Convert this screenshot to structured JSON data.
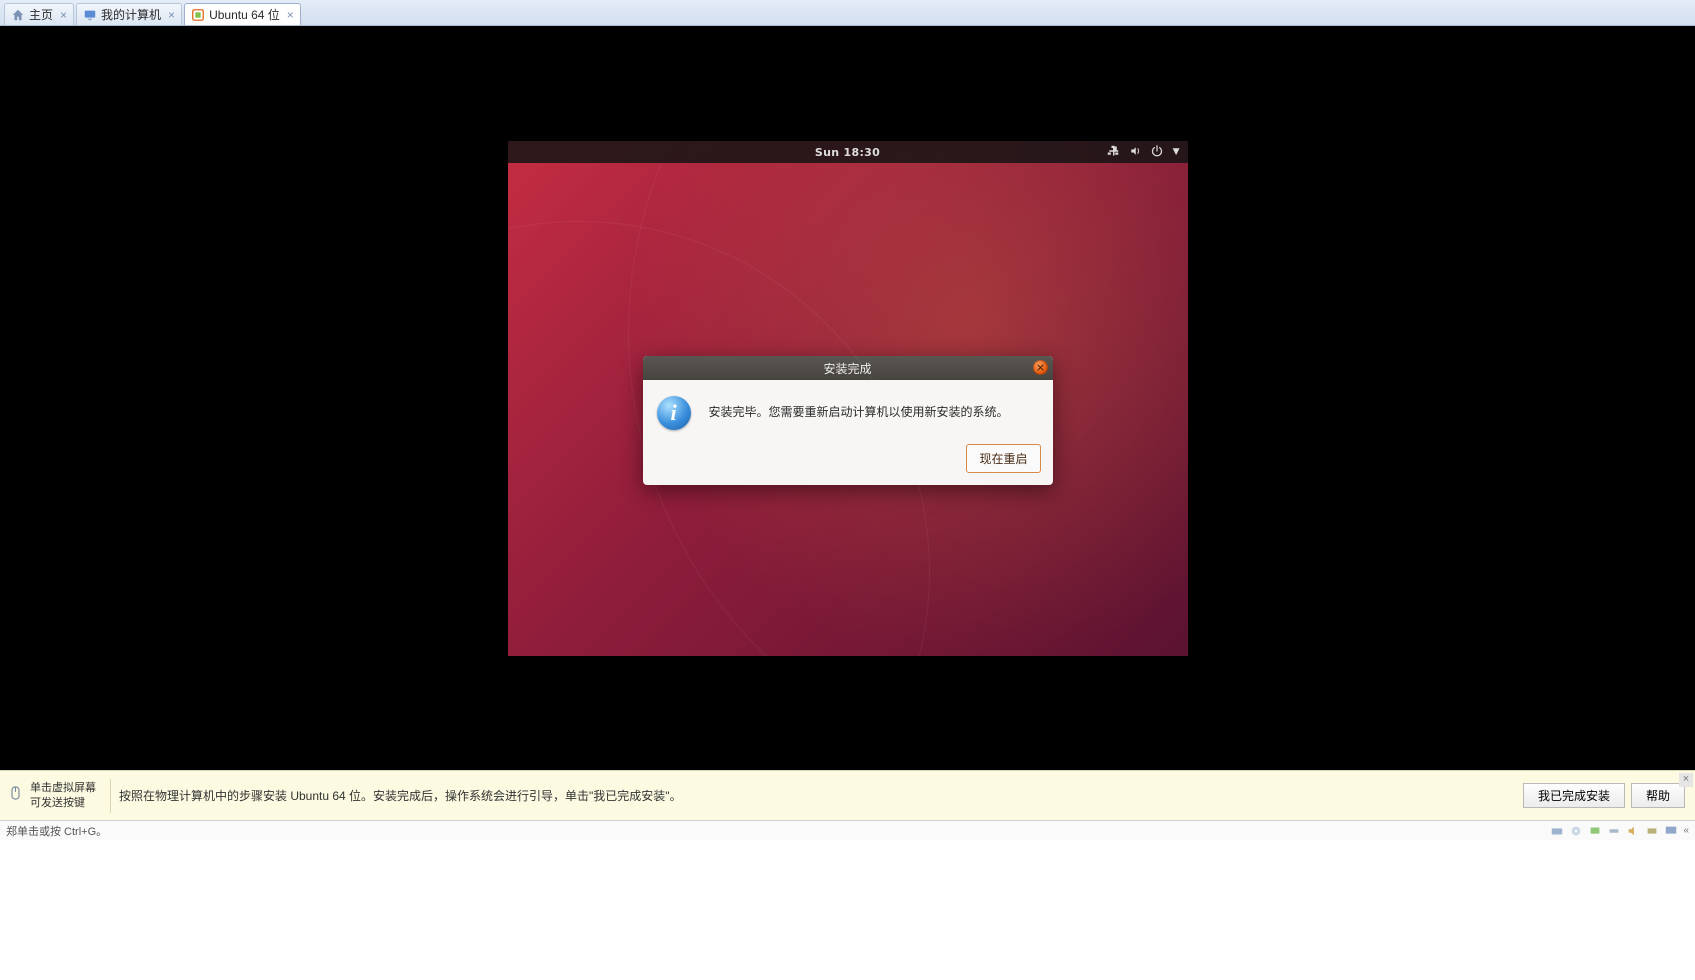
{
  "tabs": [
    {
      "label": "主页",
      "icon": "home-icon"
    },
    {
      "label": "我的计算机",
      "icon": "monitor-icon"
    },
    {
      "label": "Ubuntu 64 位",
      "icon": "vm-icon",
      "active": true
    }
  ],
  "ubuntu": {
    "clock": "Sun 18:30",
    "dialog": {
      "title": "安装完成",
      "message": "安装完毕。您需要重新启动计算机以使用新安装的系统。",
      "restart_btn": "现在重启"
    }
  },
  "hint_left_line1": "单击虚拟屏幕",
  "hint_left_line2": "可发送按键",
  "hint_main": "按照在物理计算机中的步骤安装 Ubuntu 64 位。安装完成后，操作系统会进行引导，单击\"我已完成安装\"。",
  "btn_done": "我已完成安装",
  "btn_help": "帮助",
  "status_text": "郑单击或按 Ctrl+G。"
}
